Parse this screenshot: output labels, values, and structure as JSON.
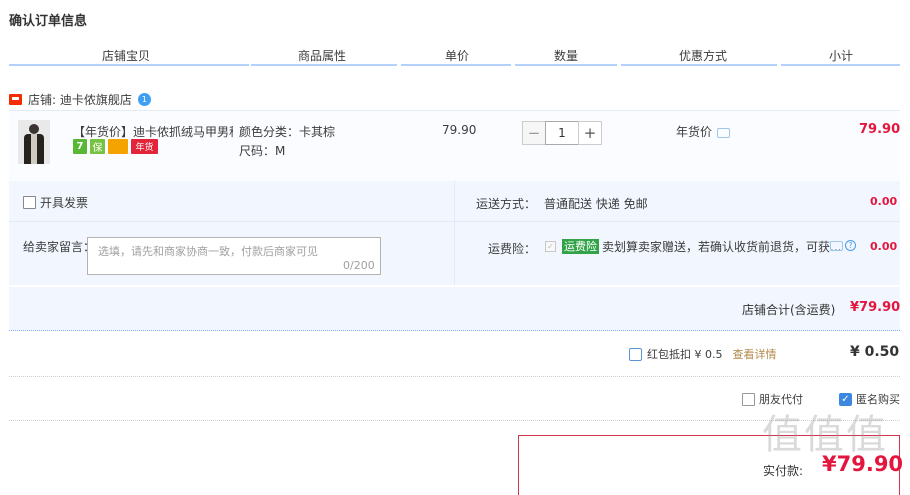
{
  "page": {
    "title": "确认订单信息"
  },
  "table_header": {
    "columns": [
      "店铺宝贝",
      "商品属性",
      "单价",
      "数量",
      "优惠方式",
      "小计"
    ]
  },
  "shop": {
    "label": "店铺: 迪卡侬旗舰店",
    "badge": "1"
  },
  "item": {
    "title": "【年货价】迪卡侬抓绒马甲男秋...",
    "icons": {
      "seven": "7",
      "bao": "保",
      "card": "",
      "nianhuo": "年货"
    },
    "prop_color": "颜色分类：卡其棕",
    "prop_size": "尺码：M",
    "unit_price": "79.90",
    "quantity": "1",
    "minus": "−",
    "plus": "+",
    "promo": "年货价",
    "subtotal": "79.90"
  },
  "options": {
    "invoice_label": "开具发票",
    "shipping_label": "运送方式：",
    "shipping_value": "普通配送 快递 免邮",
    "shipping_cost": "0.00",
    "message_label": "给卖家留言：",
    "message_placeholder": "选填，请先和商家协商一致，付款后商家可见",
    "message_count": "0/200",
    "insurance_label": "运费险：",
    "insurance_tag": "运费险",
    "insurance_text": "卖划算卖家赠送，若确认收货前退货，可获...",
    "insurance_cost": "0.00"
  },
  "shop_total": {
    "label": "店铺合计(含运费)",
    "value": "¥79.90"
  },
  "red_packet": {
    "label": "红包抵扣 ¥ 0.5",
    "link": "查看详情",
    "value": "¥ 0.50"
  },
  "purchase_opts": {
    "friend_pay": "朋友代付",
    "anonymous": "匿名购买"
  },
  "payment": {
    "label": "实付款:",
    "value": "¥79.90"
  },
  "watermark": "值值值",
  "colors": {
    "accent_red": "#e3163e",
    "header_line": "#b2d1ff",
    "light_bg": "#f2f7ff"
  }
}
